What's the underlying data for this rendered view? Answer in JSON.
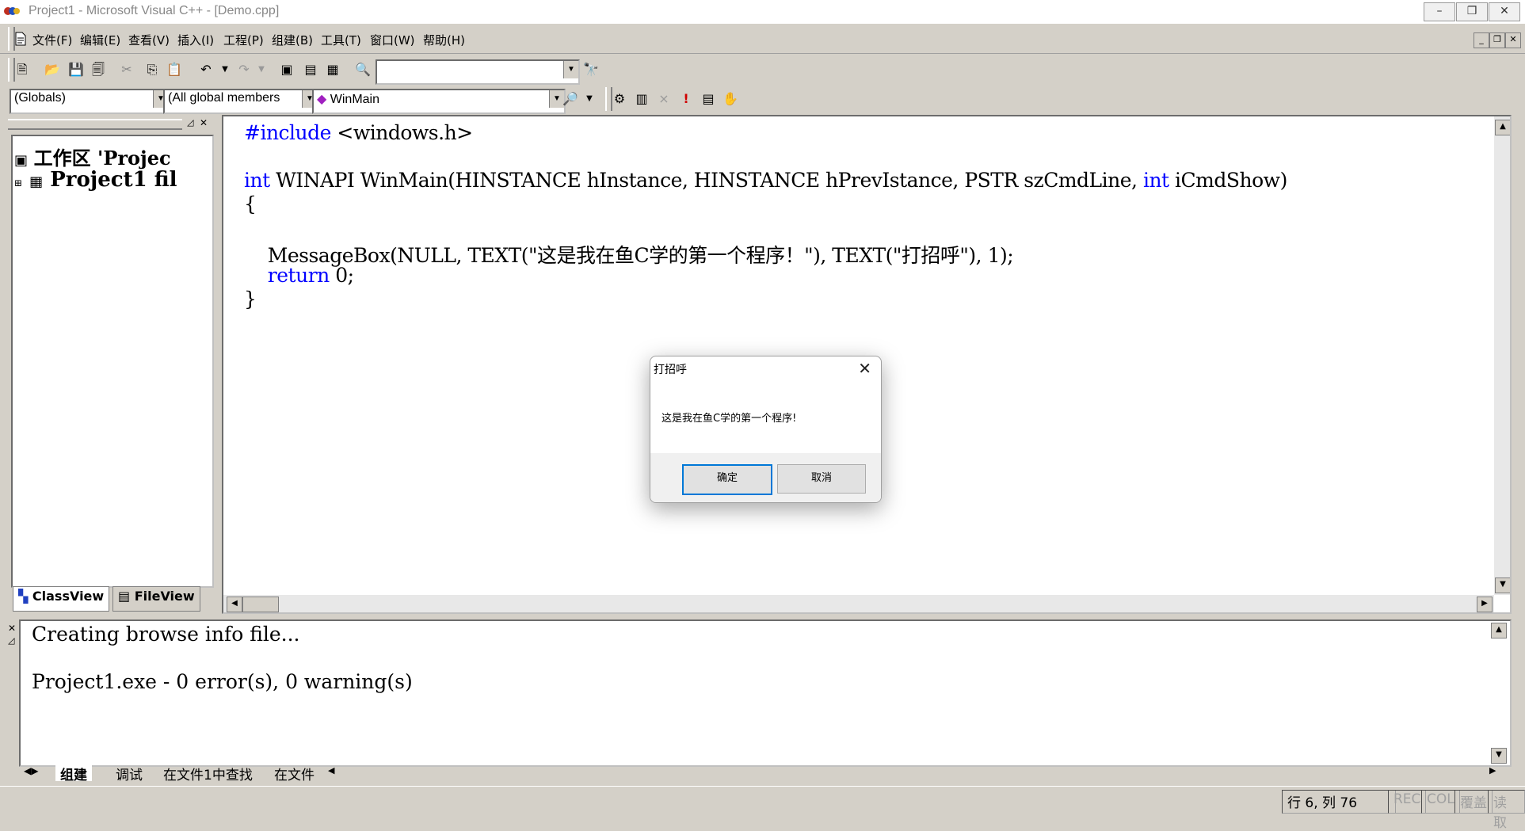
{
  "window": {
    "title": "Project1 - Microsoft Visual C++ - [Demo.cpp]",
    "controls": [
      "–",
      "❐",
      "✕"
    ]
  },
  "menu": {
    "items": [
      "文件(F)",
      "编辑(E)",
      "查看(V)",
      "插入(I)",
      "工程(P)",
      "组建(B)",
      "工具(T)",
      "窗口(W)",
      "帮助(H)"
    ],
    "mdi_controls": [
      "_",
      "❐",
      "✕"
    ]
  },
  "toolbar": {
    "find_combo_value": "",
    "class_combo": "(Globals)",
    "members_combo": "(All global members",
    "function_combo": "WinMain"
  },
  "workspace": {
    "tree_root": "工作区 'Projec",
    "tree_project": "Project1 fil",
    "tabs": [
      "ClassView",
      "FileView"
    ]
  },
  "editor": {
    "lines": [
      [
        {
          "t": "#include <windows.h>",
          "k": "mixed_include"
        }
      ],
      [],
      [
        {
          "t": "int",
          "k": "kw"
        },
        {
          "t": " WINAPI WinMain(HINSTANCE hInstance, HINSTANCE hPrevIstance, PSTR szCmdLine, ",
          "k": "n"
        },
        {
          "t": "int",
          "k": "kw"
        },
        {
          "t": " iCmdShow)",
          "k": "n"
        }
      ],
      [
        {
          "t": "{",
          "k": "n"
        }
      ],
      [],
      [
        {
          "t": "    MessageBox(NULL, TEXT(\"这是我在鱼C学的第一个程序！\"), TEXT(\"打招呼\"), 1);",
          "k": "n"
        }
      ],
      [
        {
          "t": "    ",
          "k": "n"
        },
        {
          "t": "return",
          "k": "kw"
        },
        {
          "t": " 0;",
          "k": "n"
        }
      ],
      [
        {
          "t": "}",
          "k": "n"
        }
      ]
    ]
  },
  "output": {
    "lines": [
      "Creating browse info file...",
      "",
      "Project1.exe - 0 error(s), 0 warning(s)"
    ],
    "tabs": [
      "组建",
      "调试",
      "在文件1中查找",
      "在文件"
    ]
  },
  "status": {
    "position": "行 6, 列 76",
    "indicators": [
      "REC",
      "COL",
      "覆盖",
      "读取"
    ]
  },
  "dialog": {
    "title": "打招呼",
    "message": "这是我在鱼C学的第一个程序!",
    "ok_label": "确定",
    "cancel_label": "取消"
  },
  "colors": {
    "keyword": "#0000ff",
    "chrome": "#d4d0c8",
    "dialog_default_border": "#0078d7"
  }
}
